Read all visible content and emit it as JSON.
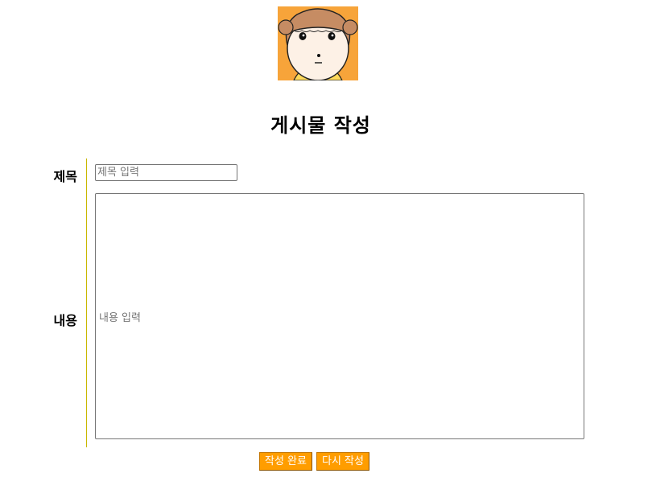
{
  "page": {
    "title": "게시물 작성"
  },
  "form": {
    "title_label": "제목",
    "title_placeholder": "제목 입력",
    "title_value": "",
    "content_label": "내용",
    "content_placeholder": "내용 입력",
    "content_value": ""
  },
  "actions": {
    "submit_label": "작성 완료",
    "reset_label": "다시 작성"
  },
  "colors": {
    "accent": "#ff9d00",
    "avatar_bg": "#f7a43a",
    "divider": "#c9b800"
  }
}
